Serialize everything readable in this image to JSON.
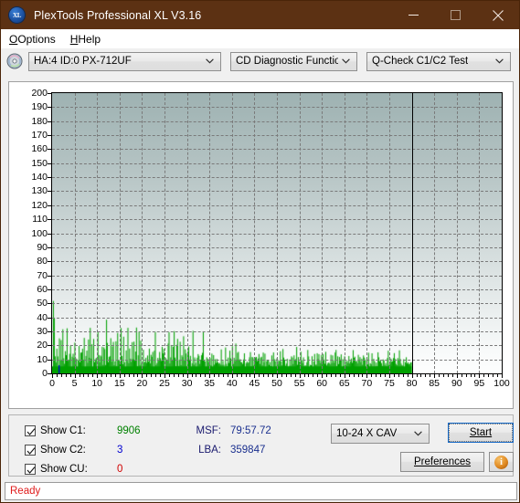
{
  "window": {
    "title": "PlexTools Professional XL V3.16",
    "icon": "xl-app-icon",
    "icon_text": "XL",
    "titlebar_color": "#5c3113",
    "controls": {
      "minimize": "minimize-icon",
      "maximize": "maximize-icon",
      "close": "close-icon"
    }
  },
  "menu": {
    "items": [
      {
        "label": "Options",
        "accel": "O"
      },
      {
        "label": "Help",
        "accel": "H"
      }
    ]
  },
  "toolbar": {
    "drive_icon": "optical-disc-icon",
    "drive_select": {
      "value": "HA:4 ID:0  PX-712UF"
    },
    "function_select": {
      "value": "CD Diagnostic Functions"
    },
    "test_select": {
      "value": "Q-Check C1/C2 Test"
    }
  },
  "chart_data": {
    "type": "bar",
    "title": "",
    "xlabel": "",
    "ylabel": "",
    "xlim": [
      0,
      100
    ],
    "ylim": [
      0,
      200
    ],
    "ytick_step": 10,
    "xtick_step": 5,
    "grid": true,
    "legend_position": "bottom-left",
    "xtick_labels": [
      "0",
      "5",
      "10",
      "15",
      "20",
      "25",
      "30",
      "35",
      "40",
      "45",
      "50",
      "55",
      "60",
      "65",
      "70",
      "75",
      "80",
      "85",
      "90",
      "95",
      "100"
    ],
    "ytick_labels": [
      "0",
      "10",
      "20",
      "30",
      "40",
      "50",
      "60",
      "70",
      "80",
      "90",
      "100",
      "110",
      "120",
      "130",
      "140",
      "150",
      "160",
      "170",
      "180",
      "190",
      "200"
    ],
    "data_end_x": 80,
    "plot_bg_top": "#9eb2b2",
    "plot_bg_bottom": "#fdfefe",
    "series": [
      {
        "name": "C1",
        "color": "#00a000",
        "x_start": 0,
        "x_end": 80,
        "values": [
          2,
          44,
          30,
          12,
          8,
          18,
          14,
          6,
          22,
          10,
          16,
          9,
          24,
          14,
          7,
          19,
          12,
          26,
          8,
          15,
          11,
          20,
          6,
          17,
          13,
          9,
          23,
          10,
          18,
          7,
          14,
          21,
          8,
          16,
          12,
          25,
          9,
          19,
          6,
          13,
          22,
          10,
          17,
          8,
          24,
          11,
          15,
          7,
          20,
          9,
          14,
          18,
          6,
          23,
          12,
          8,
          16,
          10,
          21,
          7,
          19,
          13,
          9,
          26,
          15,
          8,
          17,
          11,
          22,
          6,
          14,
          20,
          9,
          12,
          18,
          7,
          23,
          10,
          16,
          8,
          31,
          12,
          9,
          21,
          14,
          7,
          19,
          11,
          25,
          8,
          16,
          13,
          6,
          22,
          10,
          18,
          7,
          15,
          24,
          9,
          12,
          20,
          8,
          17,
          11,
          6,
          23,
          14,
          9,
          19,
          7,
          16,
          12,
          21,
          8,
          13,
          10,
          18,
          6,
          15,
          22,
          9,
          11,
          17,
          7,
          20,
          13,
          8,
          24,
          10,
          14,
          6,
          19,
          12,
          9,
          16,
          21,
          7,
          11,
          18,
          8,
          13,
          23,
          10,
          6,
          15,
          20,
          9,
          12,
          17,
          7,
          14,
          11,
          19,
          8,
          22,
          10,
          6,
          16,
          13,
          9,
          18,
          7,
          12,
          21,
          8,
          15,
          10,
          6,
          19,
          11,
          14,
          7,
          17,
          9,
          13,
          20,
          8,
          11,
          6,
          16,
          10,
          12,
          7,
          18,
          9,
          14,
          6,
          11,
          8,
          15,
          10,
          7,
          13,
          9,
          12,
          6,
          17,
          8,
          10,
          11,
          7,
          14,
          9,
          6,
          12,
          8,
          16,
          10,
          7,
          13,
          9,
          11,
          6,
          15,
          8,
          10,
          12,
          7,
          9,
          14,
          6,
          11,
          8,
          13,
          7,
          10,
          9,
          6,
          12,
          8,
          11,
          7,
          14,
          9,
          6,
          10,
          8,
          12,
          7,
          9,
          11,
          6,
          13,
          8,
          7,
          10,
          9,
          12,
          6,
          8,
          11,
          7,
          9,
          13,
          6,
          10,
          8,
          12,
          7,
          9,
          6,
          11,
          8,
          10,
          7,
          13,
          9,
          6,
          12,
          8,
          10,
          7,
          11,
          9,
          6,
          8,
          12,
          7,
          10,
          9,
          6,
          11,
          8,
          7,
          13,
          9,
          10,
          6,
          8,
          12,
          7,
          9,
          11,
          6,
          10,
          8,
          7,
          12,
          9,
          6,
          10,
          8,
          11,
          7,
          9,
          12,
          6,
          8,
          10,
          7,
          11,
          9,
          6,
          13,
          8,
          10,
          7,
          9,
          11,
          6,
          8,
          12,
          7,
          10,
          9,
          6,
          11,
          8,
          7,
          10,
          12,
          6,
          9,
          8,
          11,
          7,
          10,
          6,
          9,
          8,
          12,
          7,
          10,
          6,
          9,
          11,
          8,
          7,
          10,
          6,
          12,
          9,
          8,
          7,
          11,
          6,
          10,
          9,
          8,
          7,
          12,
          6,
          10,
          8,
          9,
          7,
          11,
          6,
          10,
          8,
          7,
          9,
          12,
          6,
          8,
          10,
          7,
          9,
          6,
          11,
          8,
          7,
          10,
          9,
          6,
          12,
          8,
          7,
          10,
          6,
          9,
          11,
          8,
          7,
          10,
          6,
          9,
          8,
          12,
          7,
          10,
          6,
          9,
          8,
          11,
          7,
          10,
          6,
          9,
          12,
          8,
          7,
          10,
          6,
          9,
          8,
          11,
          7,
          6
        ]
      },
      {
        "name": "C2",
        "color": "#0000d0",
        "x_start": 0,
        "x_end": 80,
        "values": []
      },
      {
        "name": "CU",
        "color": "#d00000",
        "x_start": 0,
        "x_end": 80,
        "values": []
      }
    ]
  },
  "results": {
    "checkboxes": [
      {
        "id": "show-c1",
        "label": "Show C1:",
        "checked": true,
        "value": "9906",
        "color": "#008000"
      },
      {
        "id": "show-c2",
        "label": "Show C2:",
        "checked": true,
        "value": "3",
        "color": "#0000d0"
      },
      {
        "id": "show-cu",
        "label": "Show CU:",
        "checked": true,
        "value": "0",
        "color": "#d00000"
      }
    ],
    "msf_label": "MSF:",
    "msf_value": "79:57.72",
    "lba_label": "LBA:",
    "lba_value": "359847",
    "speed_select": {
      "value": "10-24 X CAV"
    },
    "start_label": "Start",
    "start_accel": "S",
    "preferences_label": "Preferences",
    "preferences_accel": "P",
    "info_icon": "info-icon",
    "info_glyph": "i"
  },
  "statusbar": {
    "text": "Ready",
    "color": "#e01b1b"
  }
}
